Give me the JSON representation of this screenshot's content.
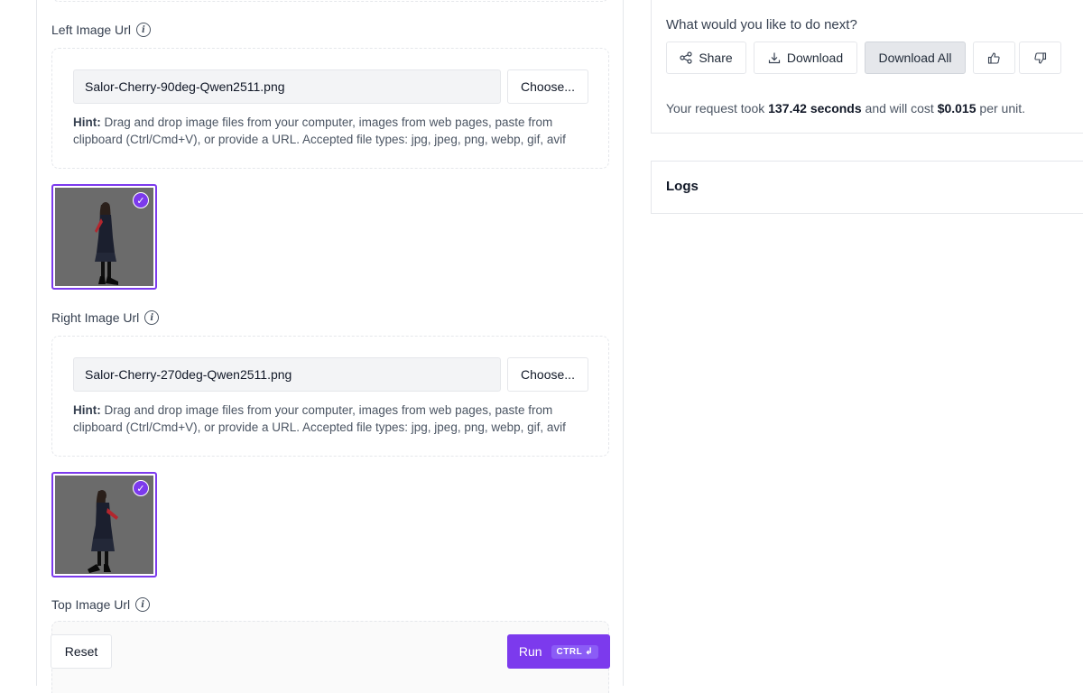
{
  "fields": [
    {
      "label": "Left Image Url",
      "value": "Salor-Cherry-90deg-Qwen2511.png"
    },
    {
      "label": "Right Image Url",
      "value": "Salor-Cherry-270deg-Qwen2511.png"
    },
    {
      "label": "Top Image Url"
    }
  ],
  "choose_label": "Choose...",
  "hint": {
    "bold": "Hint:",
    "text": "Drag and drop image files from your computer, images from web pages, paste from clipboard (Ctrl/Cmd+V), or provide a URL. Accepted file types: jpg, jpeg, png, webp, gif, avif"
  },
  "actions": {
    "reset_label": "Reset",
    "run_label": "Run",
    "run_shortcut": "CTRL ↲"
  },
  "next": {
    "title": "What would you like to do next?",
    "share_label": "Share",
    "download_label": "Download",
    "download_all_label": "Download All",
    "cost_prefix": "Your request took",
    "duration": "137.42 seconds",
    "cost_middle": "and will cost",
    "price": "$0.015",
    "cost_suffix": "per unit."
  },
  "logs": {
    "title": "Logs"
  },
  "icons": {
    "info": "info-icon",
    "share": "share-icon",
    "download": "download-icon",
    "thumbs_up": "thumbs-up-icon",
    "thumbs_down": "thumbs-down-icon",
    "check": "check-icon"
  },
  "colors": {
    "accent": "#7c3aed",
    "thumb_bg": "#6b6b6b"
  }
}
